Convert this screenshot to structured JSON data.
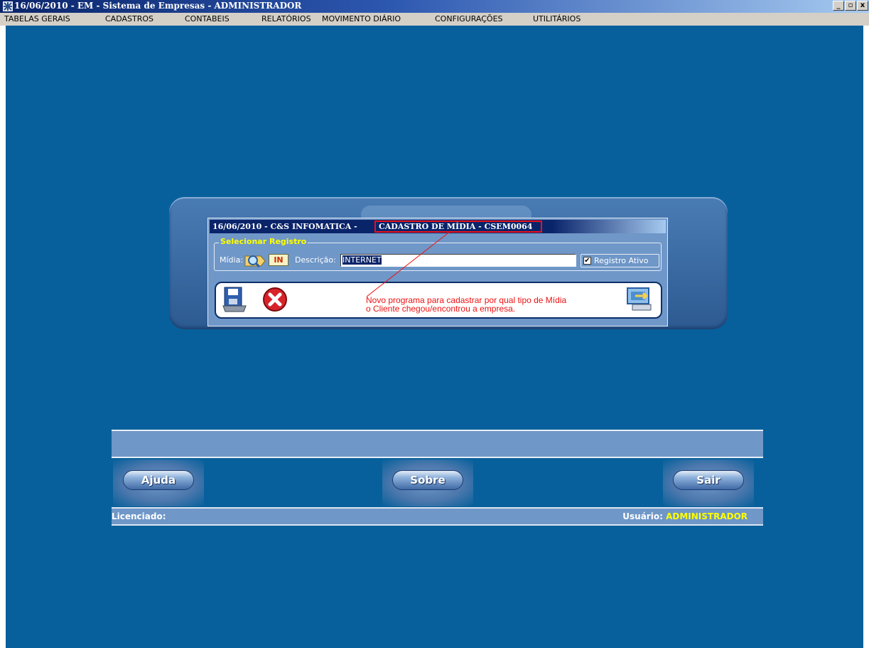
{
  "window": {
    "title": "16/06/2010  -  EM  -  Sistema de Empresas  -  ADMINISTRADOR",
    "minimize_glyph": "_",
    "maximize_glyph": "▫",
    "close_glyph": "x"
  },
  "menu": [
    {
      "label": "TABELAS GERAIS"
    },
    {
      "label": "CADASTROS"
    },
    {
      "label": "CONTABEIS"
    },
    {
      "label": "RELATÓRIOS"
    },
    {
      "label": "MOVIMENTO DIÁRIO"
    },
    {
      "label": "CONFIGURAÇÕES"
    },
    {
      "label": "UTILITÁRIOS"
    }
  ],
  "dialog": {
    "title_left": "16/06/2010  -  C&S INFOMATICA  -",
    "title_right": "CADASTRO DE MÍDIA  -  CSEM0064",
    "group_legend": "Selecionar Registro",
    "midia_label": "Mídia:",
    "midia_code": "IN",
    "descricao_label": "Descrição:",
    "descricao_value": "INTERNET",
    "registro_ativo_label": "Registro Ativo",
    "registro_ativo_checked": true,
    "check_glyph": "✔",
    "annotation_line1": "Novo programa para cadastrar por qual tipo de Mídia",
    "annotation_line2": "o Cliente chegou/encontrou a empresa."
  },
  "bottom": {
    "ajuda_label": "Ajuda",
    "sobre_label": "Sobre",
    "sair_label": "Sair",
    "licenciado_label": "Licenciado:",
    "usuario_label": "Usuário:",
    "usuario_value": "ADMINISTRADOR"
  },
  "colors": {
    "desktop": "#07609b",
    "panel": "#6f97c8",
    "title_bar": "#0a246a",
    "highlight": "#e8101a",
    "annotation": "#ee1111",
    "accent_yellow": "#ffff00"
  },
  "icons": [
    "app-icon",
    "search-icon",
    "save-icon",
    "cancel-icon",
    "exit-icon"
  ]
}
